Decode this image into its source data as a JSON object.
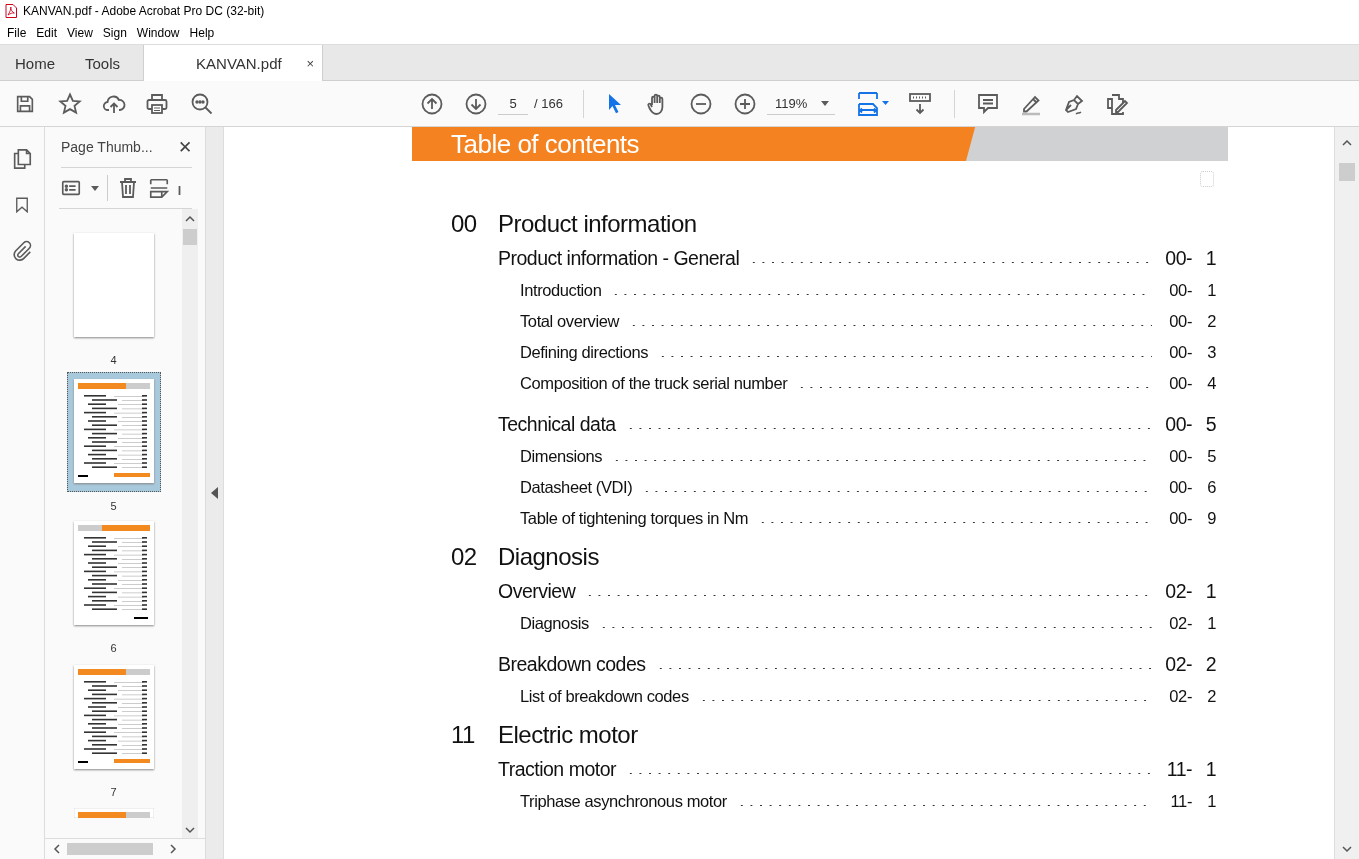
{
  "window": {
    "title": "KANVAN.pdf - Adobe Acrobat Pro DC (32-bit)"
  },
  "menu": [
    "File",
    "Edit",
    "View",
    "Sign",
    "Window",
    "Help"
  ],
  "tabs": [
    {
      "label": "Home",
      "kind": "nav",
      "selected": false
    },
    {
      "label": "Tools",
      "kind": "nav",
      "selected": false
    },
    {
      "label": "KANVAN.pdf",
      "kind": "document",
      "selected": true,
      "close": "×"
    }
  ],
  "toolbar": {
    "page": "5",
    "page_total": "/ 166",
    "zoom": "119%"
  },
  "sidebar": {
    "title": "Page Thumb...",
    "close": "✕",
    "thumbnails": [
      {
        "label": "4",
        "kind": "blank",
        "selected": false
      },
      {
        "label": "5",
        "kind": "toc",
        "selected": true
      },
      {
        "label": "6",
        "kind": "toc-alt",
        "selected": false
      },
      {
        "label": "7",
        "kind": "toc",
        "selected": false
      }
    ]
  },
  "document": {
    "header": "Table of contents",
    "sections": [
      {
        "number": "00",
        "title": "Product information",
        "entries": [
          {
            "kind": "main",
            "title": "Product information - General",
            "chapter": "00-",
            "page": "1"
          },
          {
            "kind": "sub",
            "title": "Introduction",
            "chapter": "00-",
            "page": "1"
          },
          {
            "kind": "sub",
            "title": "Total overview",
            "chapter": "00-",
            "page": "2"
          },
          {
            "kind": "sub",
            "title": "Defining directions",
            "chapter": "00-",
            "page": "3"
          },
          {
            "kind": "sub",
            "title": "Composition of the truck serial number",
            "chapter": "00-",
            "page": "4"
          },
          {
            "kind": "main",
            "title": "Technical data",
            "chapter": "00-",
            "page": "5"
          },
          {
            "kind": "sub",
            "title": "Dimensions",
            "chapter": "00-",
            "page": "5"
          },
          {
            "kind": "sub",
            "title": "Datasheet (VDI)",
            "chapter": "00-",
            "page": "6"
          },
          {
            "kind": "sub",
            "title": "Table of tightening torques in Nm",
            "chapter": "00-",
            "page": "9"
          }
        ]
      },
      {
        "number": "02",
        "title": "Diagnosis",
        "entries": [
          {
            "kind": "main",
            "title": "Overview",
            "chapter": "02-",
            "page": "1"
          },
          {
            "kind": "sub",
            "title": "Diagnosis",
            "chapter": "02-",
            "page": "1"
          },
          {
            "kind": "main",
            "title": "Breakdown codes",
            "chapter": "02-",
            "page": "2"
          },
          {
            "kind": "sub",
            "title": "List of breakdown codes",
            "chapter": "02-",
            "page": "2"
          }
        ]
      },
      {
        "number": "11",
        "title": "Electric motor",
        "entries": [
          {
            "kind": "main",
            "title": "Traction motor",
            "chapter": "11-",
            "page": "1"
          },
          {
            "kind": "sub",
            "title": "Triphase asynchronous motor",
            "chapter": "11-",
            "page": "1"
          }
        ]
      }
    ]
  }
}
